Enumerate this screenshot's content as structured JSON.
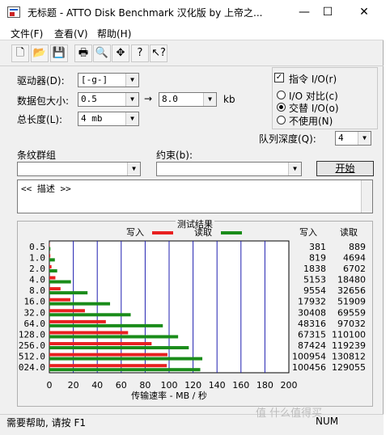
{
  "window": {
    "title": "无标题 - ATTO Disk Benchmark 汉化版 by 上帝之...",
    "icon": "disk-benchmark-icon",
    "controls": [
      "—",
      "☐",
      "✕"
    ]
  },
  "menu": [
    "文件(F)",
    "查看(V)",
    "帮助(H)"
  ],
  "toolbar": {
    "icons": [
      "new-document-icon",
      "open-folder-icon",
      "save-icon",
      "print-icon",
      "print-preview-icon",
      "move-icon",
      "help-icon",
      "context-help-icon"
    ],
    "glyphs": [
      "🗋",
      "📂",
      "💾",
      "🖶",
      "🔍",
      "✥",
      "?",
      "↖?"
    ]
  },
  "settings": {
    "drive_label": "驱动器(D):",
    "drive_value": "[-g-]",
    "packet_label": "数据包大小:",
    "packet_from": "0.5",
    "packet_arrow": "→",
    "packet_to": "8.0",
    "packet_unit": "kb",
    "length_label": "总长度(L):",
    "length_value": "4 mb",
    "stripe_label": "条纹群组",
    "constraint_label": "约束(b):",
    "stripe_value": "",
    "constraint_value": ""
  },
  "io": {
    "direct_label": "指令 I/O(r)",
    "direct_checked": "✓",
    "compare_label": "I/O 对比(c)",
    "overlap_label": "交替 I/O(o)",
    "none_label": "不使用(N)",
    "queue_label": "队列深度(Q):",
    "queue_value": "4"
  },
  "start_button": "开始",
  "description": "<< 描述 >>",
  "results": {
    "title": "测试结果",
    "legend_write": "写入",
    "legend_read": "读取",
    "col_write": "写入",
    "col_read": "读取",
    "xlabel": "传输速率 - MB / 秒"
  },
  "status": {
    "help_text": "需要帮助, 请按 F1",
    "num": "NUM"
  },
  "watermark": "值 什么值得买",
  "colors": {
    "write": "#e82020",
    "read": "#1a8c1a",
    "grid": "#2020b0"
  },
  "chart_data": {
    "type": "bar",
    "orientation": "horizontal",
    "categories": [
      "0.5",
      "1.0",
      "2.0",
      "4.0",
      "8.0",
      "16.0",
      "32.0",
      "64.0",
      "128.0",
      "256.0",
      "512.0",
      "024.0"
    ],
    "series": [
      {
        "name": "写入",
        "values": [
          381,
          819,
          1838,
          5153,
          9554,
          17932,
          30408,
          48316,
          67315,
          87424,
          100954,
          100456
        ]
      },
      {
        "name": "读取",
        "values": [
          889,
          4694,
          6702,
          18480,
          32656,
          51909,
          69559,
          97032,
          110100,
          119239,
          130812,
          129055
        ]
      }
    ],
    "x_ticks": [
      "0",
      "20",
      "40",
      "60",
      "80",
      "100",
      "120",
      "140",
      "160",
      "180",
      "200"
    ],
    "xlim": [
      0,
      200
    ],
    "xlabel": "传输速率 - MB / 秒",
    "value_unit": "KB/s",
    "grid": true,
    "legend": "top"
  }
}
